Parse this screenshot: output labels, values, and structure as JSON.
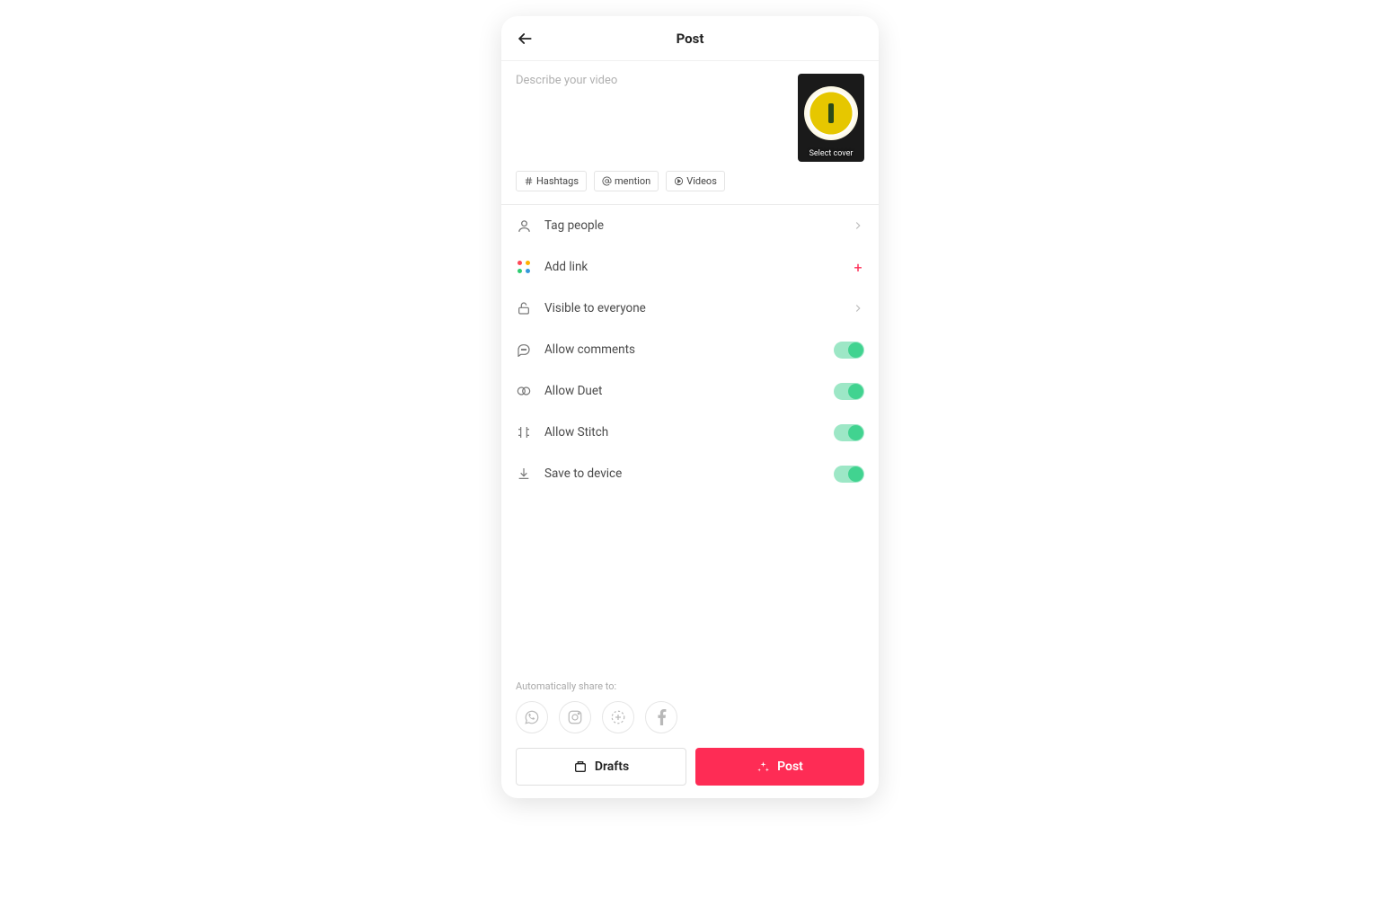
{
  "header": {
    "title": "Post"
  },
  "caption": {
    "placeholder": "Describe your video"
  },
  "cover": {
    "label": "Select cover"
  },
  "chips": {
    "hashtags": "Hashtags",
    "mention": "mention",
    "videos": "Videos"
  },
  "rows": {
    "tag_people": "Tag people",
    "add_link": "Add link",
    "visibility": "Visible to everyone",
    "allow_comments": "Allow comments",
    "allow_duet": "Allow Duet",
    "allow_stitch": "Allow Stitch",
    "save_device": "Save to device"
  },
  "toggles": {
    "allow_comments": true,
    "allow_duet": true,
    "allow_stitch": true,
    "save_device": true
  },
  "share": {
    "label": "Automatically share to:"
  },
  "buttons": {
    "drafts": "Drafts",
    "post": "Post"
  },
  "colors": {
    "accent": "#fe2c55",
    "toggle_on": "#41d390"
  }
}
